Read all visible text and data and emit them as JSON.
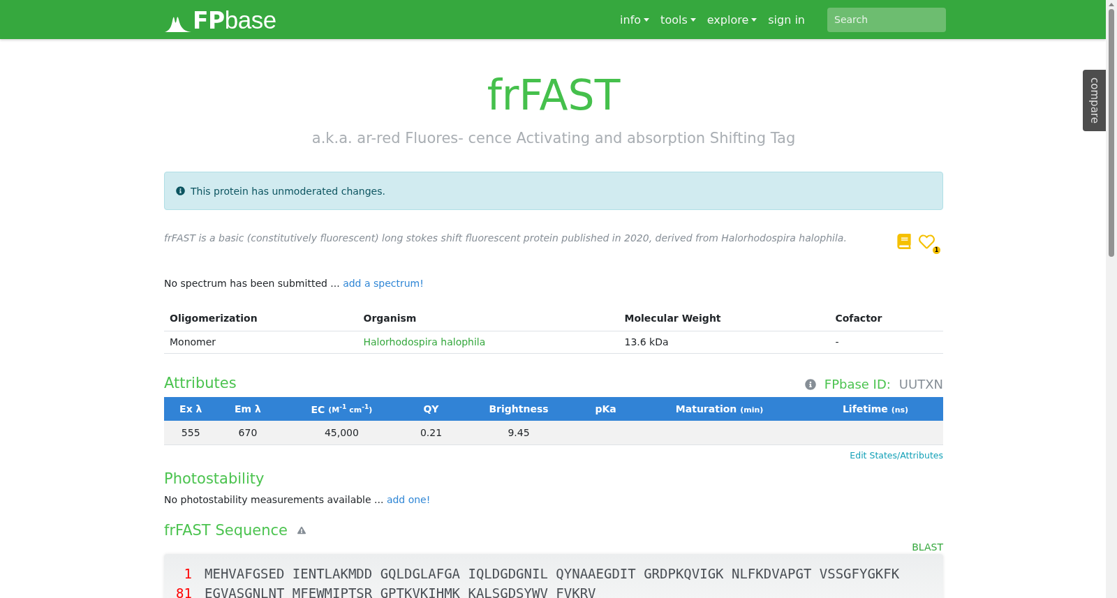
{
  "navbar": {
    "logo": {
      "strong": "FP",
      "light": "base"
    },
    "items": [
      {
        "label": "info",
        "dropdown": true
      },
      {
        "label": "tools",
        "dropdown": true
      },
      {
        "label": "explore",
        "dropdown": true
      },
      {
        "label": "sign in",
        "dropdown": false
      }
    ],
    "search": {
      "placeholder": "Search"
    }
  },
  "compare_tab": {
    "label": "compare"
  },
  "title": "frFAST",
  "subtitle": "a.k.a. ar-red Fluores- cence Activating and absorption Shifting Tag",
  "alert": {
    "text": "This protein has unmoderated changes."
  },
  "description": "frFAST is a basic (constitutively fluorescent) long stokes shift fluorescent protein published in 2020, derived from Halorhodospira halophila.",
  "favorite": {
    "count": "1"
  },
  "spectrum_note": {
    "text": "No spectrum has been submitted ...",
    "link": "add a spectrum!"
  },
  "info_table": {
    "columns": [
      "Oligomerization",
      "Organism",
      "Molecular Weight",
      "Cofactor"
    ],
    "row": [
      {
        "text": "Monomer",
        "link": false
      },
      {
        "text": "Halorhodospira halophila",
        "link": true
      },
      {
        "text": "13.6 kDa",
        "link": false
      },
      {
        "text": "-",
        "link": false
      }
    ]
  },
  "attributes": {
    "heading": "Attributes",
    "id_label": "FPbase ID:",
    "id_value": "UUTXN",
    "columns": [
      {
        "label": "Ex λ",
        "value": "555"
      },
      {
        "label": "Em λ",
        "value": "670"
      },
      {
        "label": "EC",
        "unit": "(M$^{-1}$ cm$^{-1}$)",
        "value": "45,000"
      },
      {
        "label": "QY",
        "value": "0.21"
      },
      {
        "label": "Brightness",
        "value": "9.45"
      },
      {
        "label": "pKa"
      },
      {
        "label": "Maturation",
        "unit": "(min)"
      },
      {
        "label": "Lifetime",
        "unit": "(ns)"
      }
    ],
    "edit_link": "Edit States/Attributes"
  },
  "photostability": {
    "heading": "Photostability",
    "text": "No photostability measurements available ...",
    "link": "add one!"
  },
  "sequence": {
    "heading": "frFAST Sequence",
    "blast": "BLAST",
    "lines": [
      {
        "number": "1",
        "text": "MEHVAFGSED IENTLAKMDD GQLDGLAFGA IQLDGDGNIL QYNAAEGDIT GRDPKQVIGK NLFKDVAPGT VSSGFYGKFK"
      },
      {
        "number": "81",
        "text": "EGVASGNLNT MFEWMIPTSR GPTKVKIHMK KALSGDSYWV FVKRV"
      }
    ]
  }
}
